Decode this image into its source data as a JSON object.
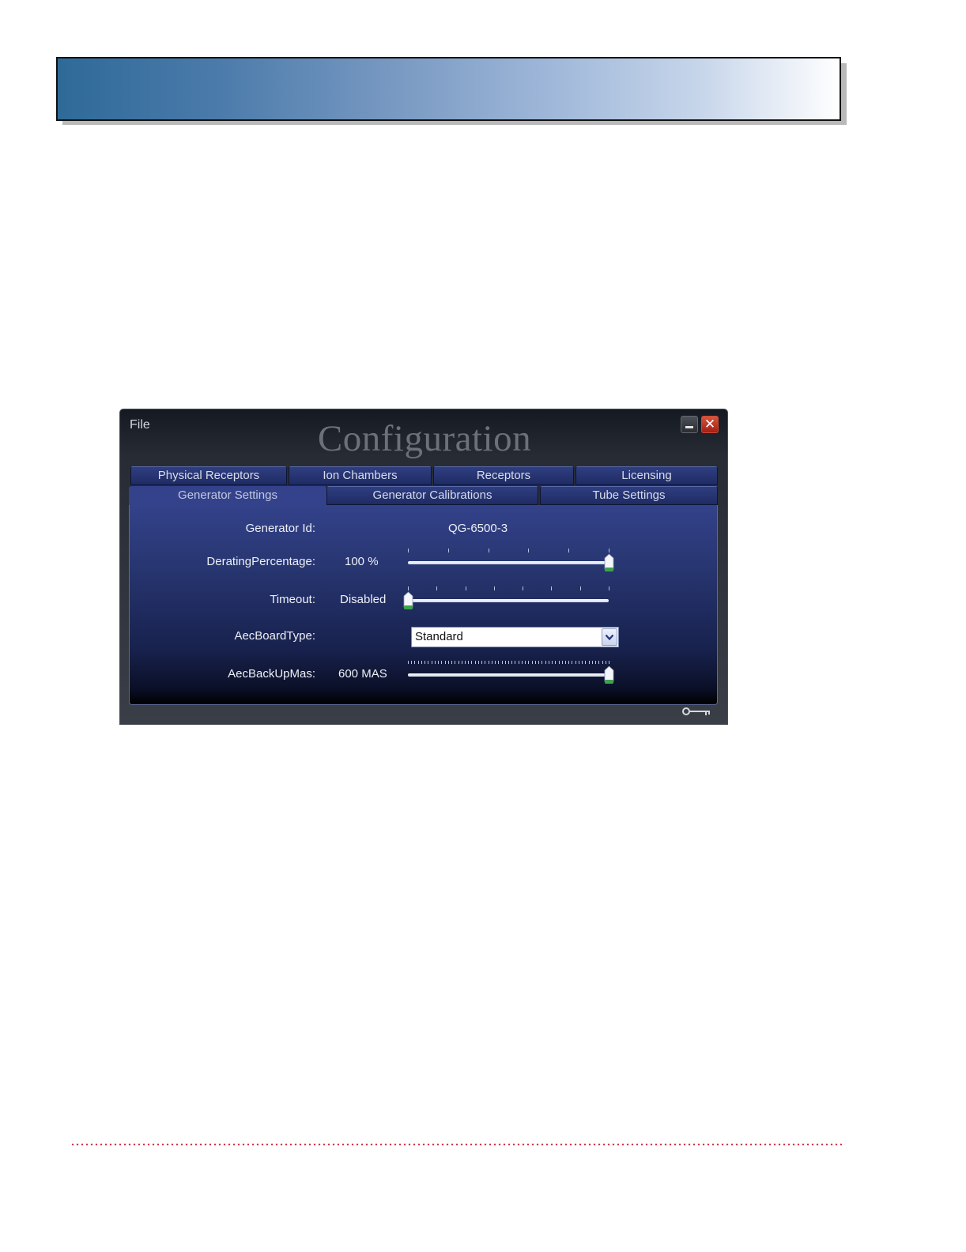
{
  "window": {
    "menu_file": "File",
    "title": "Configuration"
  },
  "tabs_row1": [
    "Physical Receptors",
    "Ion Chambers",
    "Receptors",
    "Licensing"
  ],
  "tabs_row2": [
    "Generator Settings",
    "Generator Calibrations",
    "Tube Settings"
  ],
  "active_tab": "Generator Settings",
  "form": {
    "generator_id_label": "Generator Id:",
    "generator_id_value": "QG-6500-3",
    "derating_label": "DeratingPercentage:",
    "derating_value": "100 %",
    "derating_level": 1.0,
    "timeout_label": "Timeout:",
    "timeout_value": "Disabled",
    "timeout_level": 0.0,
    "aec_board_label": "AecBoardType:",
    "aec_board_value": "Standard",
    "aec_backup_label": "AecBackUpMas:",
    "aec_backup_value": "600 MAS",
    "aec_backup_level": 1.0
  },
  "colors": {
    "banner_start": "#2e6a98",
    "panel": "#33428a",
    "close_button": "#c0321f",
    "footer_dots": "#d23a4a"
  },
  "icons": [
    "minimize-icon",
    "close-icon",
    "chevron-down-icon",
    "key-icon"
  ]
}
